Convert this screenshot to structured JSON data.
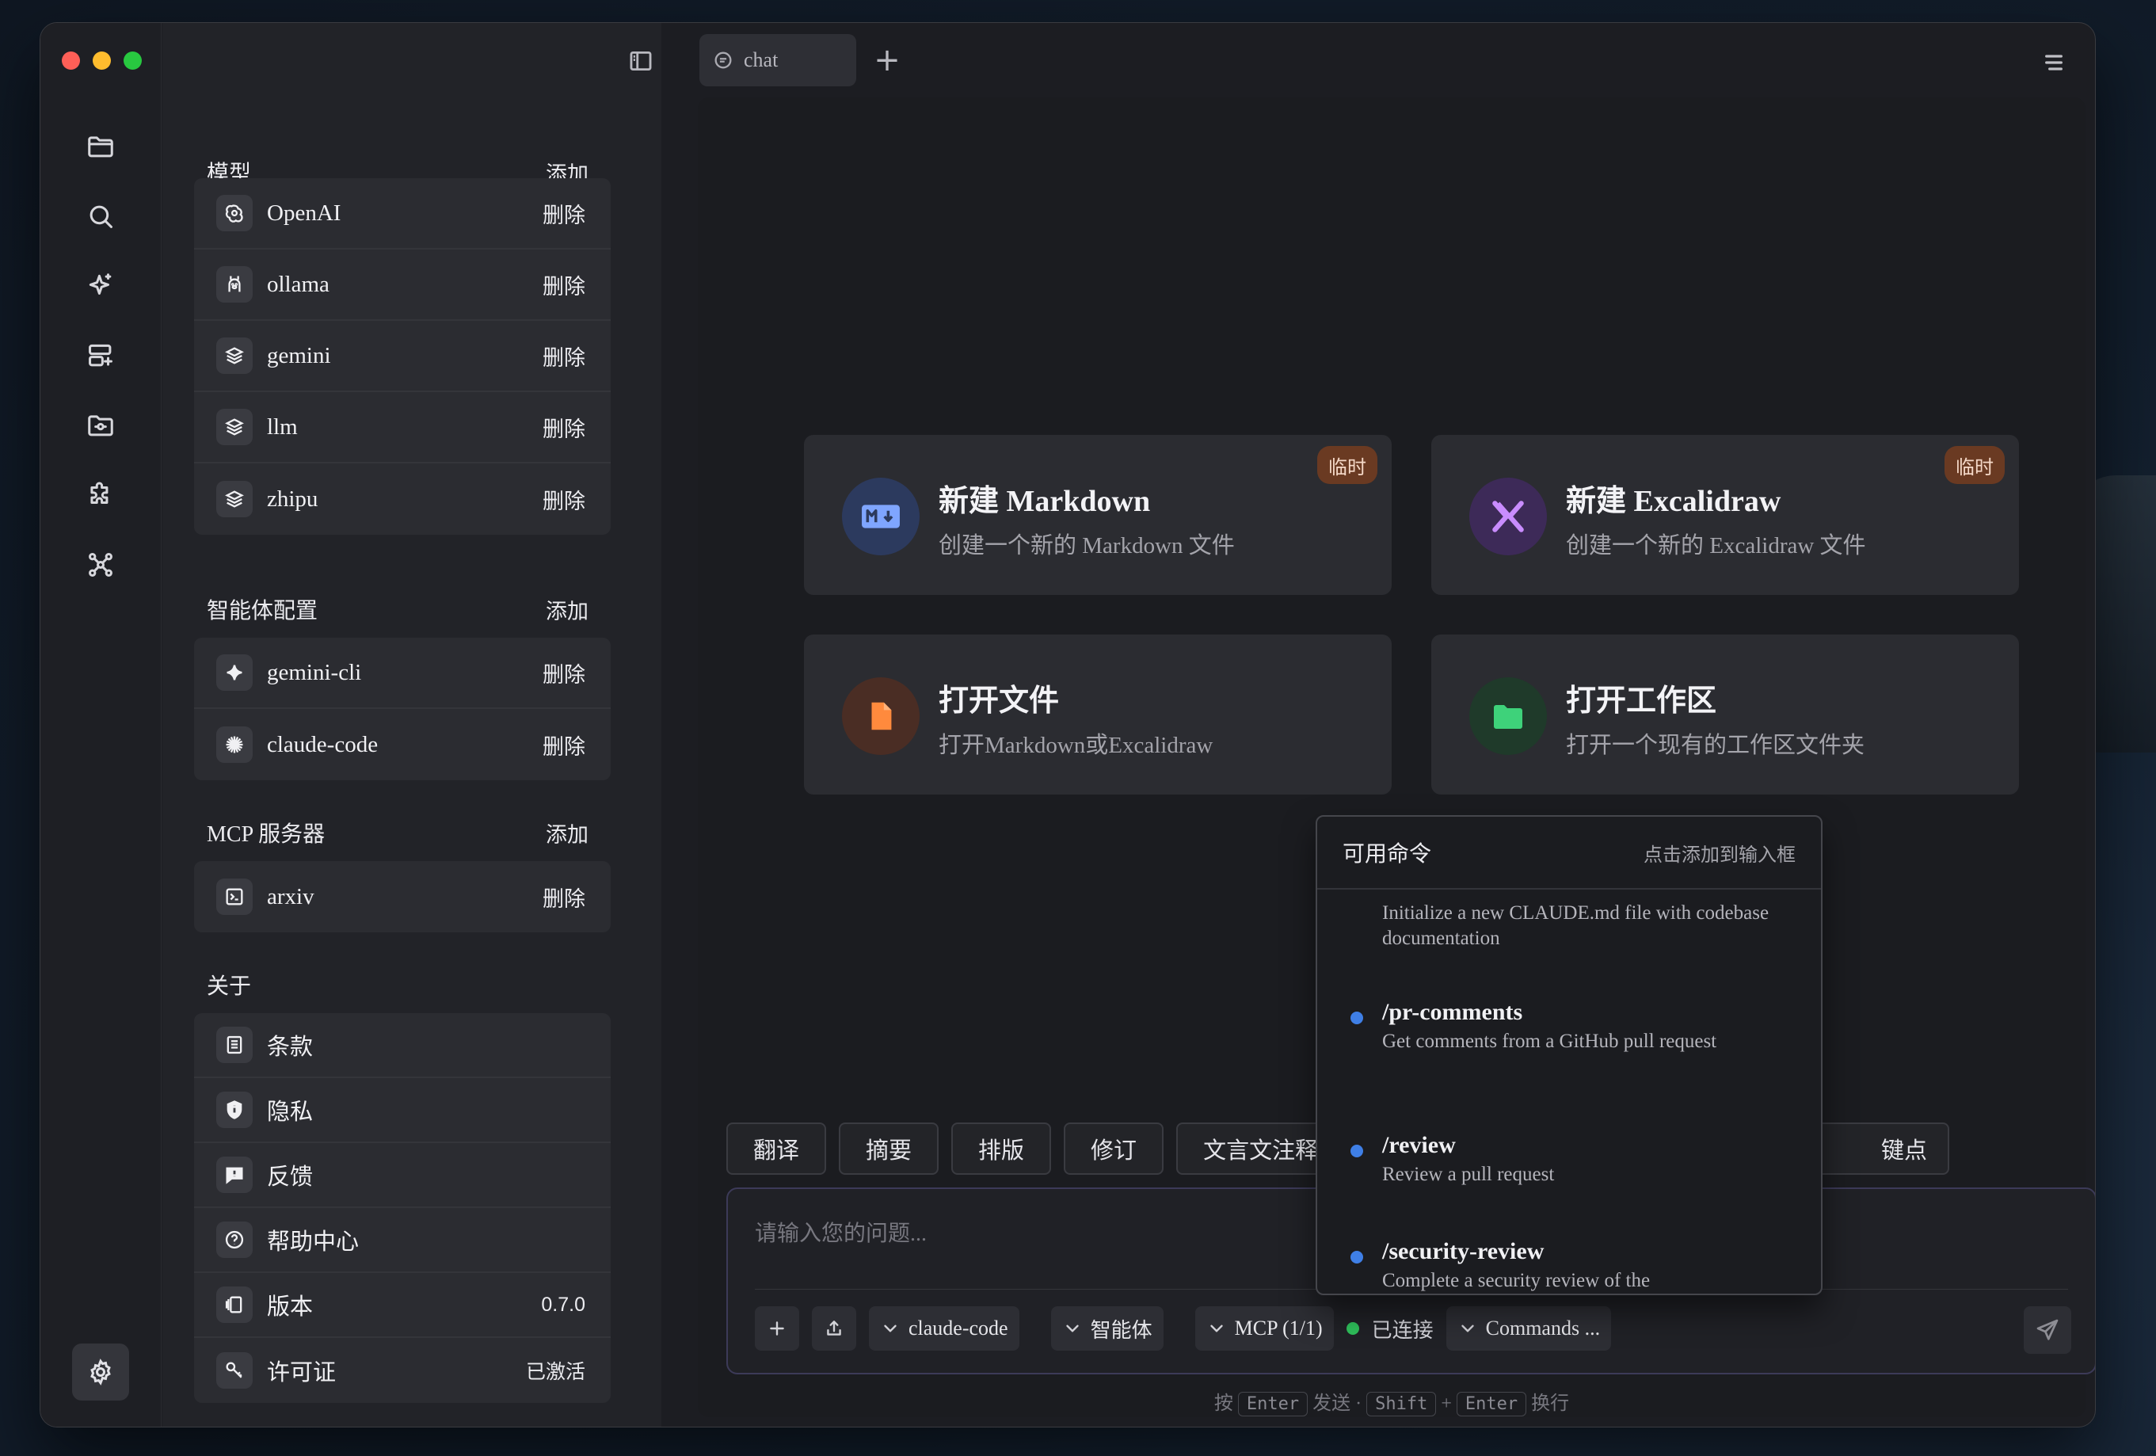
{
  "tab": {
    "label": "chat"
  },
  "sidebar": {
    "models": {
      "title": "模型",
      "add_label": "添加",
      "items": [
        {
          "label": "OpenAI",
          "action": "删除",
          "icon": "openai-icon"
        },
        {
          "label": "ollama",
          "action": "删除",
          "icon": "ollama-icon"
        },
        {
          "label": "gemini",
          "action": "删除",
          "icon": "layers-icon"
        },
        {
          "label": "llm",
          "action": "删除",
          "icon": "layers-icon"
        },
        {
          "label": "zhipu",
          "action": "删除",
          "icon": "layers-icon"
        }
      ]
    },
    "agents": {
      "title": "智能体配置",
      "add_label": "添加",
      "items": [
        {
          "label": "gemini-cli",
          "action": "删除",
          "icon": "sparkle-icon"
        },
        {
          "label": "claude-code",
          "action": "删除",
          "icon": "asterisk-icon"
        }
      ]
    },
    "mcp": {
      "title": "MCP 服务器",
      "add_label": "添加",
      "items": [
        {
          "label": "arxiv",
          "action": "删除",
          "icon": "terminal-icon"
        }
      ]
    },
    "about": {
      "title": "关于",
      "items": [
        {
          "label": "条款",
          "value": "",
          "icon": "document-icon"
        },
        {
          "label": "隐私",
          "value": "",
          "icon": "shield-icon"
        },
        {
          "label": "反馈",
          "value": "",
          "icon": "feedback-icon"
        },
        {
          "label": "帮助中心",
          "value": "",
          "icon": "help-icon"
        },
        {
          "label": "版本",
          "value": "0.7.0",
          "icon": "version-icon"
        },
        {
          "label": "许可证",
          "value": "已激活",
          "icon": "key-icon"
        }
      ]
    }
  },
  "cards": [
    {
      "title": "新建 Markdown",
      "desc": "创建一个新的 Markdown 文件",
      "badge": "临时",
      "icon": "markdown-icon",
      "color": "#2c3a5e"
    },
    {
      "title": "新建 Excalidraw",
      "desc": "创建一个新的 Excalidraw 文件",
      "badge": "临时",
      "icon": "excalidraw-icon",
      "color": "#3d2a58"
    },
    {
      "title": "打开文件",
      "desc": "打开Markdown或Excalidraw",
      "badge": "",
      "icon": "file-icon",
      "color": "#4a2d24"
    },
    {
      "title": "打开工作区",
      "desc": "打开一个现有的工作区文件夹",
      "badge": "",
      "icon": "folder-icon",
      "color": "#1f3a2a"
    }
  ],
  "chips": [
    "翻译",
    "摘要",
    "排版",
    "修订",
    "文言文注释"
  ],
  "chip_partial": "键点",
  "input": {
    "placeholder": "请输入您的问题...",
    "agent_select": "claude-code",
    "agent_menu": "智能体",
    "mcp_menu": "MCP (1/1)",
    "status": "已连接",
    "commands": "Commands ..."
  },
  "hint": {
    "press": "按",
    "enter": "Enter",
    "send": "发送 ·",
    "shift": "Shift",
    "plus": "+",
    "enter2": "Enter",
    "newline": "换行"
  },
  "popup": {
    "title": "可用命令",
    "hint": "点击添加到输入框",
    "commands": [
      {
        "name": "",
        "desc": "Initialize a new CLAUDE.md file with codebase documentation"
      },
      {
        "name": "/pr-comments",
        "desc": "Get comments from a GitHub pull request"
      },
      {
        "name": "/review",
        "desc": "Review a pull request"
      },
      {
        "name": "/security-review",
        "desc": "Complete a security review of the"
      }
    ]
  },
  "colors": {
    "accent_dot": "#3f7fe6",
    "status_connected": "#2fbf5b",
    "badge_bg": "#6a3a22"
  }
}
